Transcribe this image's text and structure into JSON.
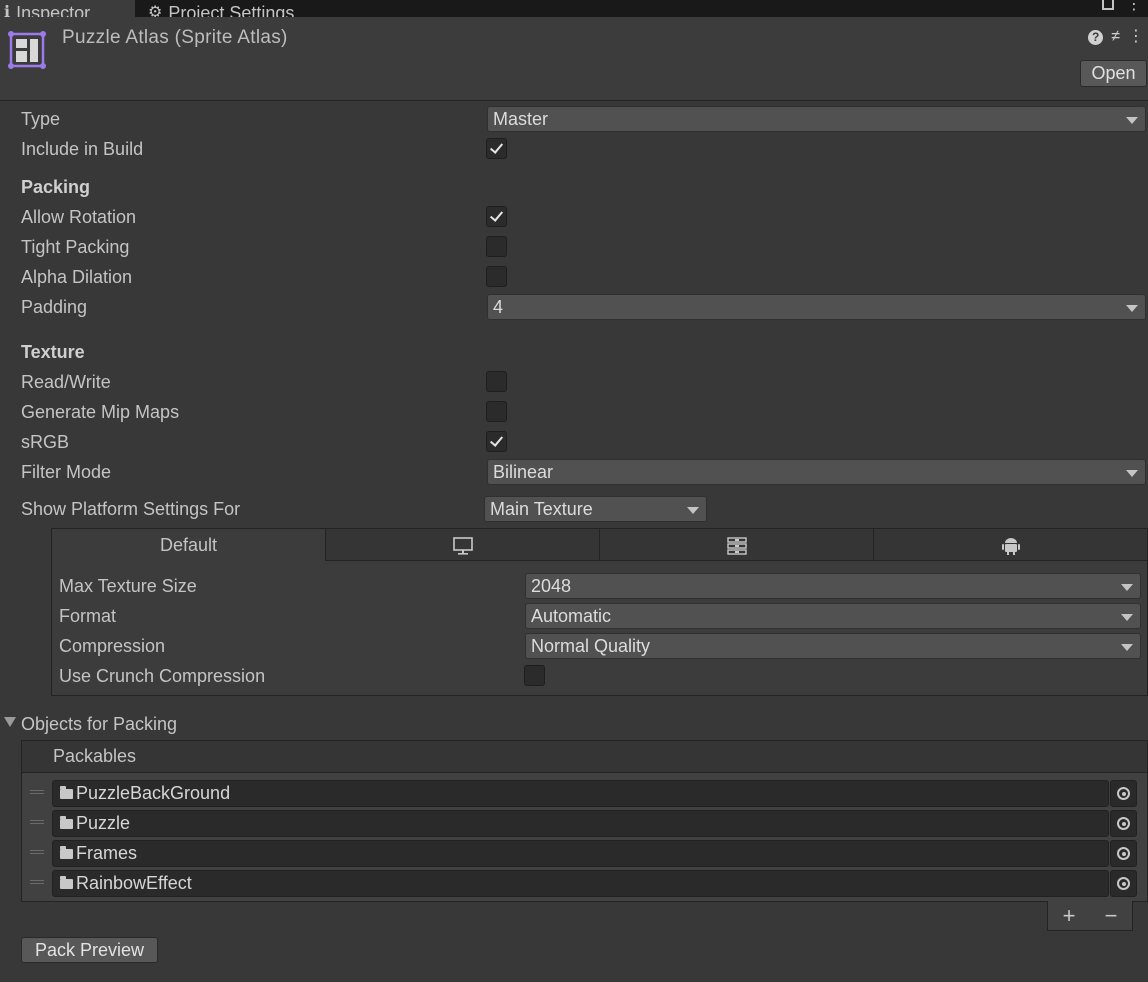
{
  "tabs": {
    "inspector_label": "Inspector",
    "project_settings_label": "Project Settings"
  },
  "header": {
    "title": "Puzzle Atlas (Sprite Atlas)",
    "open_label": "Open"
  },
  "properties": {
    "type_label": "Type",
    "type_value": "Master",
    "include_in_build_label": "Include in Build",
    "include_in_build": true,
    "packing_section": "Packing",
    "allow_rotation_label": "Allow Rotation",
    "allow_rotation": true,
    "tight_packing_label": "Tight Packing",
    "tight_packing": false,
    "alpha_dilation_label": "Alpha Dilation",
    "alpha_dilation": false,
    "padding_label": "Padding",
    "padding_value": "4",
    "texture_section": "Texture",
    "read_write_label": "Read/Write",
    "read_write": false,
    "generate_mip_maps_label": "Generate Mip Maps",
    "generate_mip_maps": false,
    "srgb_label": "sRGB",
    "srgb": true,
    "filter_mode_label": "Filter Mode",
    "filter_mode_value": "Bilinear",
    "show_platform_label": "Show Platform Settings For",
    "show_platform_value": "Main Texture"
  },
  "platform": {
    "tabs": [
      {
        "label": "Default",
        "icon": ""
      },
      {
        "label": "",
        "icon": "monitor-icon"
      },
      {
        "label": "",
        "icon": "server-icon"
      },
      {
        "label": "",
        "icon": "android-icon"
      }
    ],
    "max_texture_size_label": "Max Texture Size",
    "max_texture_size_value": "2048",
    "format_label": "Format",
    "format_value": "Automatic",
    "compression_label": "Compression",
    "compression_value": "Normal Quality",
    "use_crunch_label": "Use Crunch Compression",
    "use_crunch": false
  },
  "objects": {
    "foldout_label": "Objects for Packing",
    "list_header": "Packables",
    "items": [
      {
        "name": "PuzzleBackGround"
      },
      {
        "name": "Puzzle"
      },
      {
        "name": "Frames"
      },
      {
        "name": "RainbowEffect"
      }
    ],
    "add_label": "+",
    "remove_label": "−"
  },
  "footer": {
    "pack_preview_label": "Pack Preview"
  },
  "colors": {
    "background": "#383838",
    "atlas_icon_accent": "#9b7bea"
  }
}
